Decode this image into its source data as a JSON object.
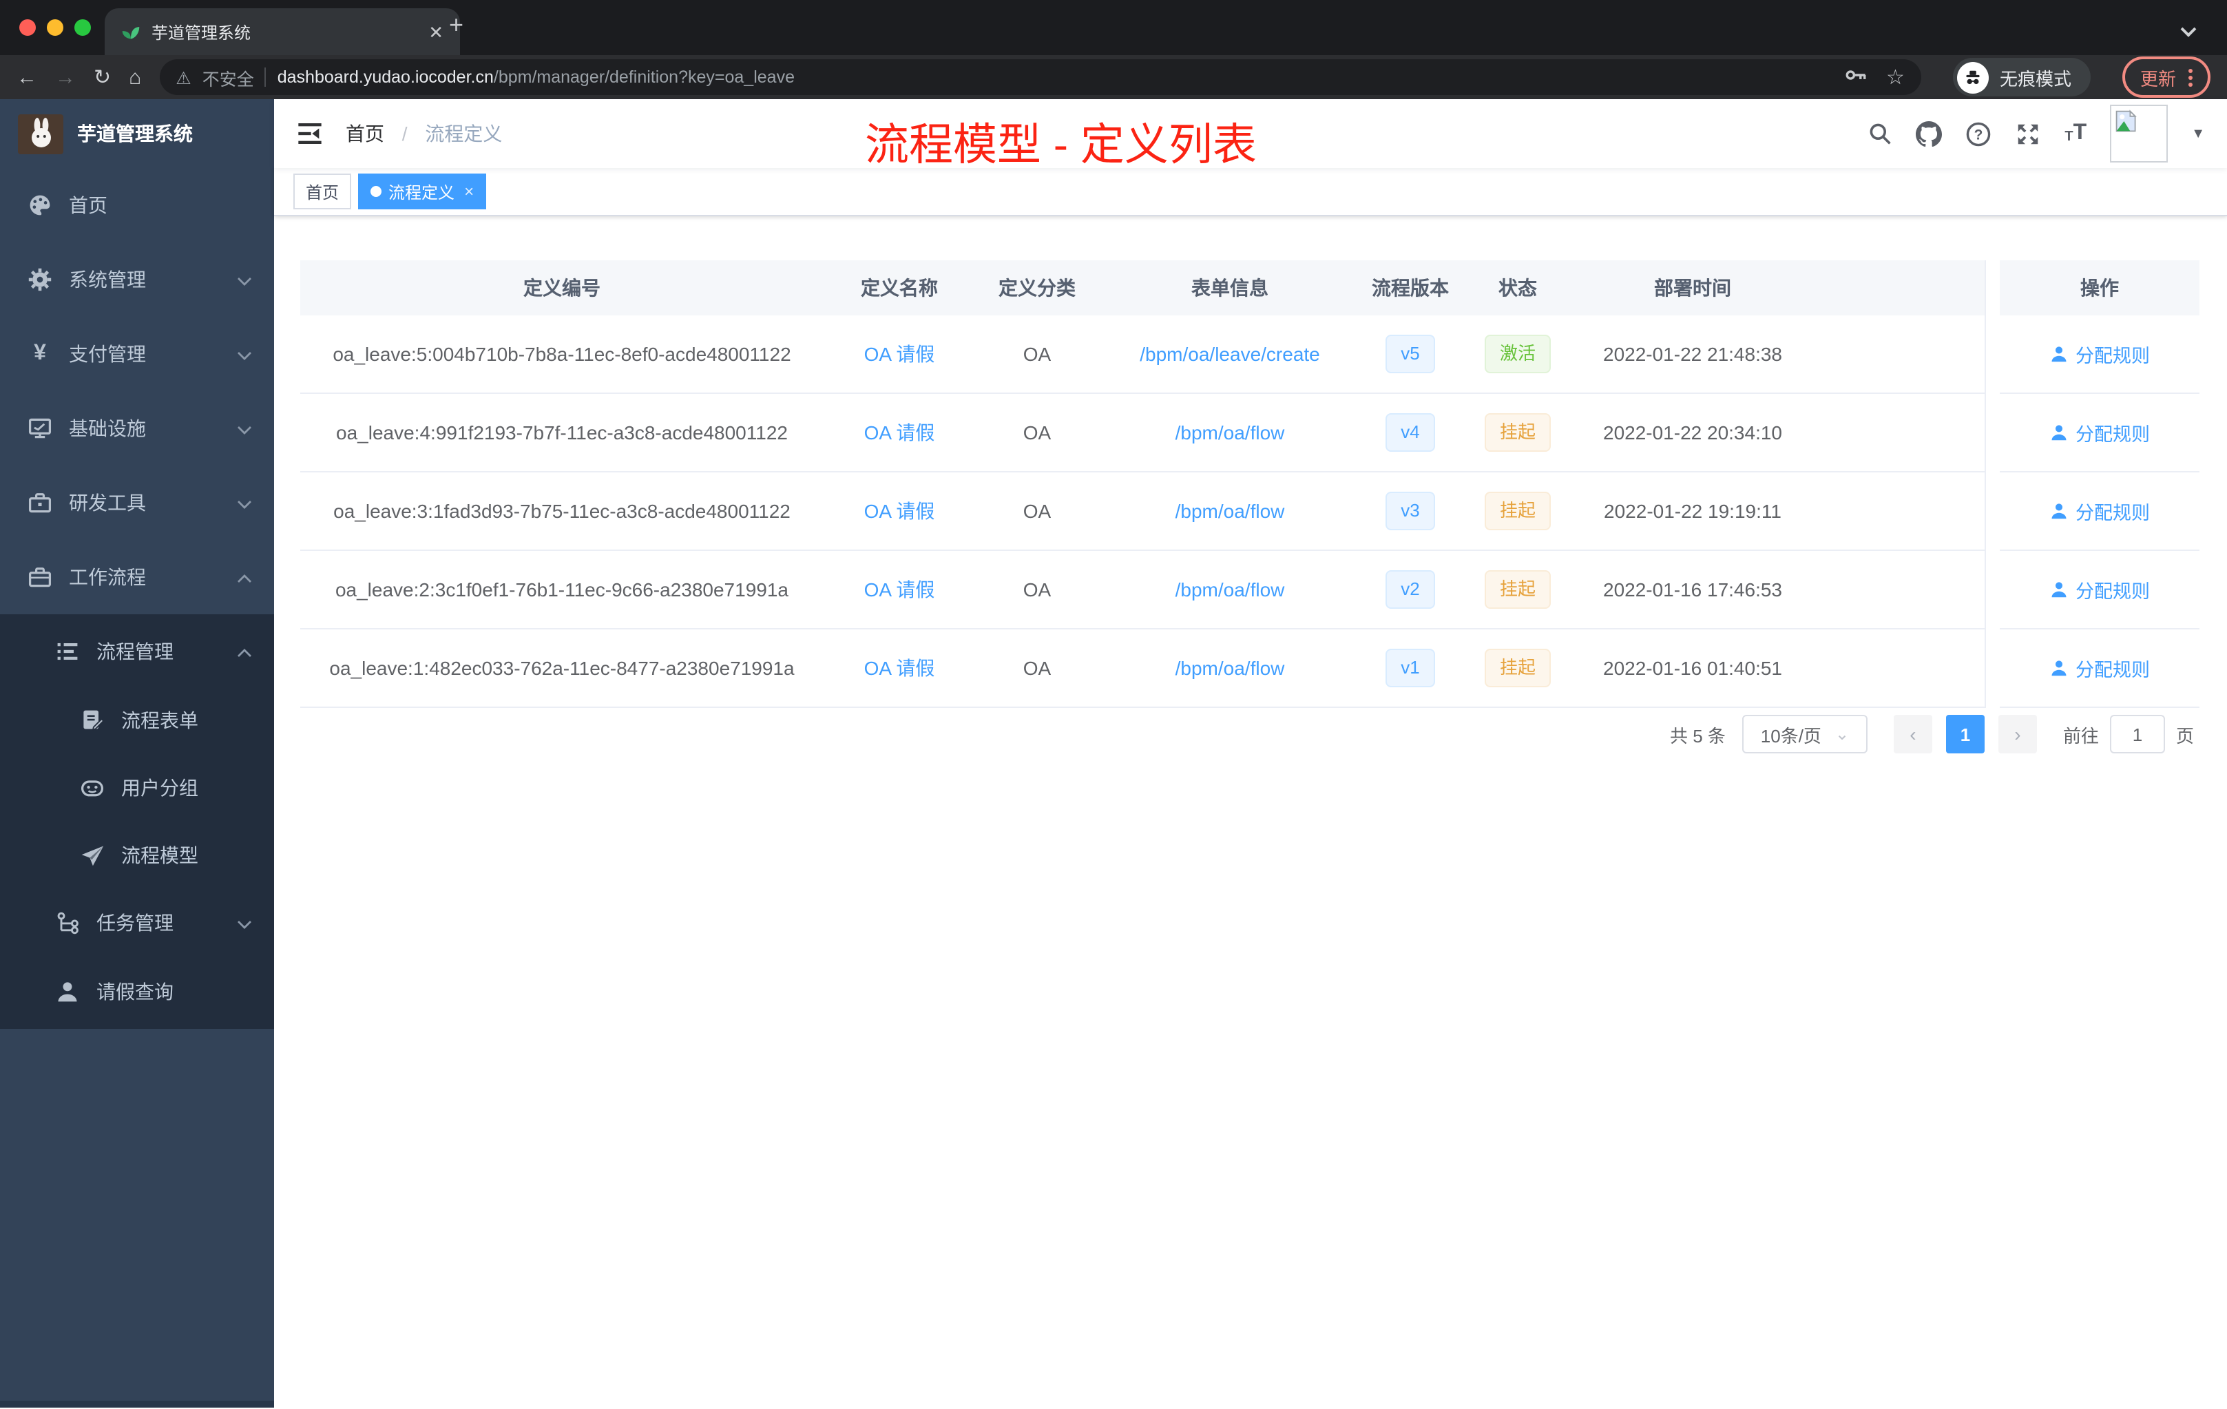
{
  "browser": {
    "tab_title": "芋道管理系统",
    "new_tab": "+",
    "security_label": "不安全",
    "url_host": "dashboard.yudao.iocoder.cn",
    "url_path": "/bpm/manager/definition?key=oa_leave",
    "incognito_label": "无痕模式",
    "update_label": "更新"
  },
  "sidebar": {
    "logo_title": "芋道管理系统",
    "items": [
      {
        "label": "首页"
      },
      {
        "label": "系统管理"
      },
      {
        "label": "支付管理"
      },
      {
        "label": "基础设施"
      },
      {
        "label": "研发工具"
      },
      {
        "label": "工作流程"
      }
    ],
    "workflow_submenu": {
      "process_mgmt": "流程管理",
      "children": [
        "流程表单",
        "用户分组",
        "流程模型"
      ],
      "task_mgmt": "任务管理",
      "leave_query": "请假查询"
    }
  },
  "header": {
    "breadcrumb_home": "首页",
    "breadcrumb_current": "流程定义",
    "annotation": "流程模型 - 定义列表"
  },
  "tags": {
    "home": "首页",
    "active": "流程定义",
    "close": "×"
  },
  "table": {
    "columns": [
      "定义编号",
      "定义名称",
      "定义分类",
      "表单信息",
      "流程版本",
      "状态",
      "部署时间",
      "操作"
    ],
    "action_label": "分配规则",
    "rows": [
      {
        "id": "oa_leave:5:004b710b-7b8a-11ec-8ef0-acde48001122",
        "name": "OA 请假",
        "category": "OA",
        "form": "/bpm/oa/leave/create",
        "version": "v5",
        "status": "激活",
        "status_type": "success",
        "time": "2022-01-22 21:48:38"
      },
      {
        "id": "oa_leave:4:991f2193-7b7f-11ec-a3c8-acde48001122",
        "name": "OA 请假",
        "category": "OA",
        "form": "/bpm/oa/flow",
        "version": "v4",
        "status": "挂起",
        "status_type": "warning",
        "time": "2022-01-22 20:34:10"
      },
      {
        "id": "oa_leave:3:1fad3d93-7b75-11ec-a3c8-acde48001122",
        "name": "OA 请假",
        "category": "OA",
        "form": "/bpm/oa/flow",
        "version": "v3",
        "status": "挂起",
        "status_type": "warning",
        "time": "2022-01-22 19:19:11"
      },
      {
        "id": "oa_leave:2:3c1f0ef1-76b1-11ec-9c66-a2380e71991a",
        "name": "OA 请假",
        "category": "OA",
        "form": "/bpm/oa/flow",
        "version": "v2",
        "status": "挂起",
        "status_type": "warning",
        "time": "2022-01-16 17:46:53"
      },
      {
        "id": "oa_leave:1:482ec033-762a-11ec-8477-a2380e71991a",
        "name": "OA 请假",
        "category": "OA",
        "form": "/bpm/oa/flow",
        "version": "v1",
        "status": "挂起",
        "status_type": "warning",
        "time": "2022-01-16 01:40:51"
      }
    ]
  },
  "pagination": {
    "total": "共 5 条",
    "page_size": "10条/页",
    "current_page": "1",
    "goto_label": "前往",
    "goto_value": "1",
    "page_unit": "页"
  },
  "colors": {
    "accent": "#409eff",
    "annotation_red": "#fb2313",
    "sidebar_bg": "#334358",
    "submenu_bg": "#222d3d",
    "success": "#67c23a",
    "warning": "#e6a23c"
  }
}
